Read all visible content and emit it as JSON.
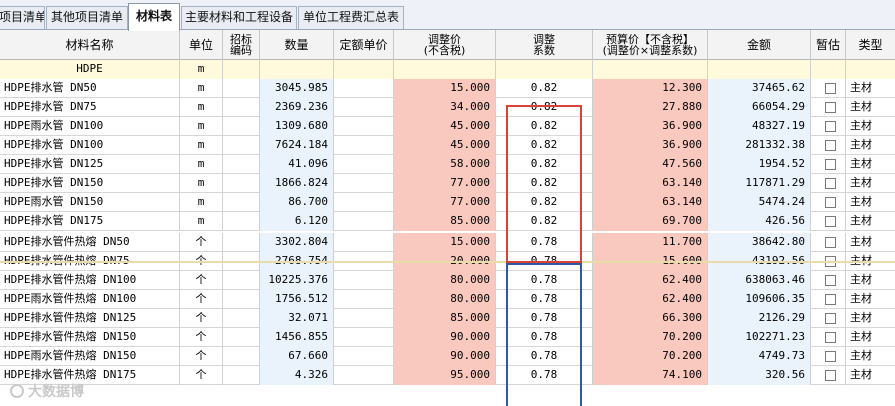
{
  "tabs": [
    {
      "label": "项目清单",
      "active": false
    },
    {
      "label": "其他项目清单",
      "active": false
    },
    {
      "label": "材料表",
      "active": true
    },
    {
      "label": "主要材料和工程设备",
      "active": false
    },
    {
      "label": "单位工程费汇总表",
      "active": false
    }
  ],
  "columns": {
    "name": "材料名称",
    "unit": "单位",
    "bid_code_1": "招标",
    "bid_code_2": "编码",
    "qty": "数量",
    "quota_price": "定额单价",
    "adj_price_1": "调整价",
    "adj_price_2": "(不含税)",
    "coef_1": "调整",
    "coef_2": "系数",
    "budget_1": "预算价【不含税】",
    "budget_2": "(调整价×调整系数)",
    "amount": "金额",
    "provisional": "暂估",
    "category": "类型"
  },
  "group_header": {
    "name": "HDPE",
    "unit": "m"
  },
  "rows": [
    {
      "name": "HDPE排水管 DN50",
      "unit": "m",
      "qty": "3045.985",
      "price": "15.000",
      "coef": "0.82",
      "budget": "12.300",
      "amount": "37465.62",
      "type": "主材"
    },
    {
      "name": "HDPE排水管 DN75",
      "unit": "m",
      "qty": "2369.236",
      "price": "34.000",
      "coef": "0.82",
      "budget": "27.880",
      "amount": "66054.29",
      "type": "主材"
    },
    {
      "name": "HDPE雨水管 DN100",
      "unit": "m",
      "qty": "1309.680",
      "price": "45.000",
      "coef": "0.82",
      "budget": "36.900",
      "amount": "48327.19",
      "type": "主材"
    },
    {
      "name": "HDPE排水管 DN100",
      "unit": "m",
      "qty": "7624.184",
      "price": "45.000",
      "coef": "0.82",
      "budget": "36.900",
      "amount": "281332.38",
      "type": "主材"
    },
    {
      "name": "HDPE排水管 DN125",
      "unit": "m",
      "qty": "41.096",
      "price": "58.000",
      "coef": "0.82",
      "budget": "47.560",
      "amount": "1954.52",
      "type": "主材"
    },
    {
      "name": "HDPE排水管 DN150",
      "unit": "m",
      "qty": "1866.824",
      "price": "77.000",
      "coef": "0.82",
      "budget": "63.140",
      "amount": "117871.29",
      "type": "主材"
    },
    {
      "name": "HDPE雨水管 DN150",
      "unit": "m",
      "qty": "86.700",
      "price": "77.000",
      "coef": "0.82",
      "budget": "63.140",
      "amount": "5474.24",
      "type": "主材"
    },
    {
      "name": "HDPE排水管 DN175",
      "unit": "m",
      "qty": "6.120",
      "price": "85.000",
      "coef": "0.82",
      "budget": "69.700",
      "amount": "426.56",
      "type": "主材"
    },
    {
      "name": "HDPE排水管件热熔 DN50",
      "unit": "个",
      "qty": "3302.804",
      "price": "15.000",
      "coef": "0.78",
      "budget": "11.700",
      "amount": "38642.80",
      "type": "主材"
    },
    {
      "name": "HDPE排水管件热熔 DN75",
      "unit": "个",
      "qty": "2768.754",
      "price": "20.000",
      "coef": "0.78",
      "budget": "15.600",
      "amount": "43192.56",
      "type": "主材"
    },
    {
      "name": "HDPE排水管件热熔 DN100",
      "unit": "个",
      "qty": "10225.376",
      "price": "80.000",
      "coef": "0.78",
      "budget": "62.400",
      "amount": "638063.46",
      "type": "主材"
    },
    {
      "name": "HDPE雨水管件热熔 DN100",
      "unit": "个",
      "qty": "1756.512",
      "price": "80.000",
      "coef": "0.78",
      "budget": "62.400",
      "amount": "109606.35",
      "type": "主材"
    },
    {
      "name": "HDPE排水管件热熔 DN125",
      "unit": "个",
      "qty": "32.071",
      "price": "85.000",
      "coef": "0.78",
      "budget": "66.300",
      "amount": "2126.29",
      "type": "主材"
    },
    {
      "name": "HDPE排水管件热熔 DN150",
      "unit": "个",
      "qty": "1456.855",
      "price": "90.000",
      "coef": "0.78",
      "budget": "70.200",
      "amount": "102271.23",
      "type": "主材"
    },
    {
      "name": "HDPE雨水管件热熔 DN150",
      "unit": "个",
      "qty": "67.660",
      "price": "90.000",
      "coef": "0.78",
      "budget": "70.200",
      "amount": "4749.73",
      "type": "主材"
    },
    {
      "name": "HDPE排水管件热熔 DN175",
      "unit": "个",
      "qty": "4.326",
      "price": "95.000",
      "coef": "0.78",
      "budget": "74.100",
      "amount": "320.56",
      "type": "主材"
    }
  ],
  "watermark": "大数据博",
  "colors": {
    "price_bg": "#f9c9c0",
    "qty_bg": "#eaf3fb",
    "red_box": "#d84235",
    "blue_box": "#2f57a8"
  }
}
